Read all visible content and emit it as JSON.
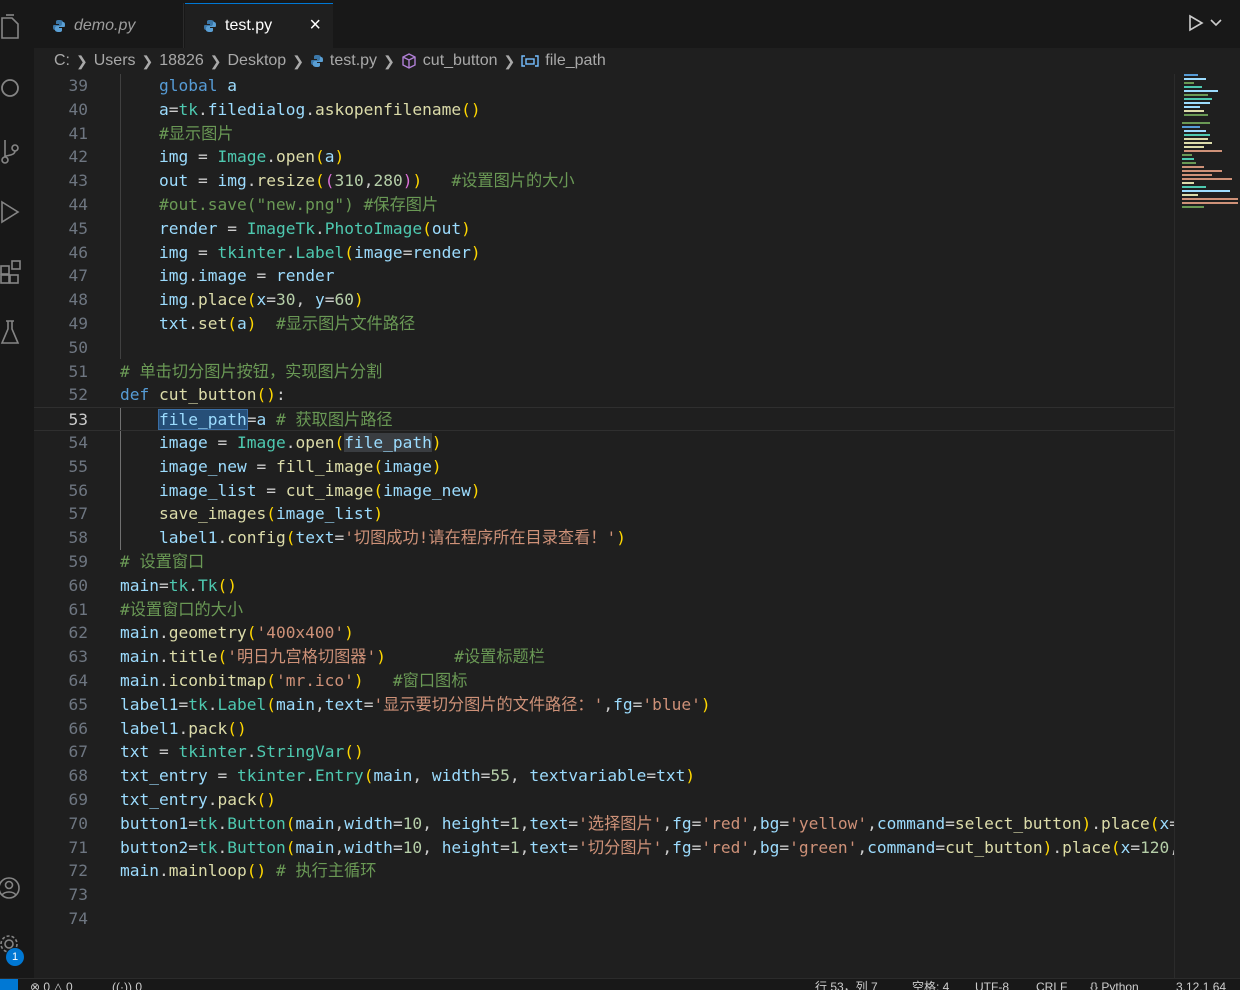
{
  "tabs": [
    {
      "label": "demo.py",
      "active": false
    },
    {
      "label": "test.py",
      "active": true
    }
  ],
  "tab_close_icon": "×",
  "breadcrumb": [
    "C:",
    "Users",
    "18826",
    "Desktop",
    "test.py",
    "cut_button",
    "file_path"
  ],
  "accounts_badge": "1",
  "status": {
    "errors": "0",
    "warnings": "0",
    "ports": "0",
    "position": "行 53，列 7",
    "spaces": "空格: 4",
    "encoding": "UTF-8",
    "eol": "CRLF",
    "language": "Python",
    "interpreter": "3.12.1 64"
  },
  "current_line": 53,
  "lines": [
    {
      "n": "39"
    },
    {
      "n": "40"
    },
    {
      "n": "41"
    },
    {
      "n": "42"
    },
    {
      "n": "43"
    },
    {
      "n": "44"
    },
    {
      "n": "45"
    },
    {
      "n": "46"
    },
    {
      "n": "47"
    },
    {
      "n": "48"
    },
    {
      "n": "49"
    },
    {
      "n": "50"
    },
    {
      "n": "51"
    },
    {
      "n": "52"
    },
    {
      "n": "53"
    },
    {
      "n": "54"
    },
    {
      "n": "55"
    },
    {
      "n": "56"
    },
    {
      "n": "57"
    },
    {
      "n": "58"
    },
    {
      "n": "59"
    },
    {
      "n": "60"
    },
    {
      "n": "61"
    },
    {
      "n": "62"
    },
    {
      "n": "63"
    },
    {
      "n": "64"
    },
    {
      "n": "65"
    },
    {
      "n": "66"
    },
    {
      "n": "67"
    },
    {
      "n": "68"
    },
    {
      "n": "69"
    },
    {
      "n": "70"
    },
    {
      "n": "71"
    },
    {
      "n": "72"
    },
    {
      "n": "73"
    },
    {
      "n": "74"
    }
  ],
  "code": {
    "l39": "    global a",
    "l40": "    a=tk.filedialog.askopenfilename()",
    "l41": "    #显示图片",
    "l42": "    img = Image.open(a)",
    "l43": "    out = img.resize((310,280))   #设置图片的大小",
    "l44": "    #out.save(\"new.png\") #保存图片",
    "l45": "    render = ImageTk.PhotoImage(out)",
    "l46": "    img = tkinter.Label(image=render)",
    "l47": "    img.image = render",
    "l48": "    img.place(x=30, y=60)",
    "l49": "    txt.set(a)  #显示图片文件路径",
    "l50": "",
    "l51": "# 单击切分图片按钮，实现图片分割",
    "l52": "def cut_button():",
    "l53": "    file_path=a # 获取图片路径",
    "l54": "    image = Image.open(file_path)",
    "l55": "    image_new = fill_image(image)",
    "l56": "    image_list = cut_image(image_new)",
    "l57": "    save_images(image_list)",
    "l58": "    label1.config(text='切图成功!请在程序所在目录查看！')",
    "l59": "# 设置窗口",
    "l60": "main=tk.Tk()",
    "l61": "#设置窗口的大小",
    "l62": "main.geometry('400x400')",
    "l63": "main.title('明日九宫格切图器')       #设置标题栏",
    "l64": "main.iconbitmap('mr.ico')   #窗口图标",
    "l65": "label1=tk.Label(main,text='显示要切分图片的文件路径：',fg='blue')",
    "l66": "label1.pack()",
    "l67": "txt = tkinter.StringVar()",
    "l68": "txt_entry = tkinter.Entry(main, width=55, textvariable=txt)",
    "l69": "txt_entry.pack()",
    "l70": "button1=tk.Button(main,width=10, height=1,text='选择图片',fg='red',bg='yellow',command=select_button).place(x=",
    "l71": "button2=tk.Button(main,width=10, height=1,text='切分图片',fg='red',bg='green',command=cut_button).place(x=120,",
    "l72": "main.mainloop() # 执行主循环",
    "l73": "",
    "l74": ""
  },
  "colors": {
    "keyword": "#569cd6",
    "function": "#dcdcaa",
    "class": "#4ec9b0",
    "variable": "#9cdcfe",
    "string": "#ce9178",
    "number": "#b5cea8",
    "comment": "#6a9955",
    "accent": "#0078d4"
  },
  "icons": {
    "activity": [
      "explorer-icon",
      "search-icon",
      "source-control-icon",
      "run-debug-icon",
      "extensions-icon",
      "testing-icon",
      "accounts-icon",
      "settings-gear-icon"
    ],
    "tabs": "python-file-icon",
    "breadcrumb_method": "method-cube-icon",
    "breadcrumb_variable": "variable-icon"
  }
}
